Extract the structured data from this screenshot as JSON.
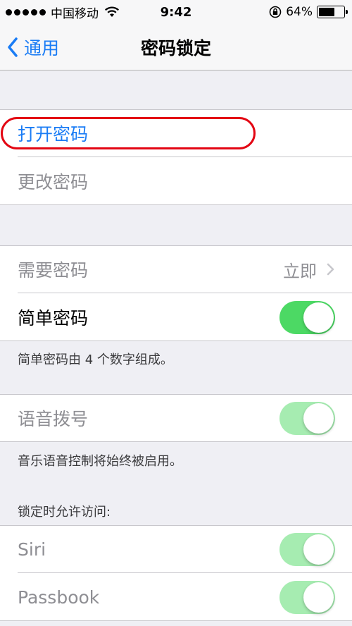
{
  "status_bar": {
    "carrier": "中国移动",
    "time": "9:42",
    "battery_percent": "64%",
    "battery_level": 0.64
  },
  "nav": {
    "back_label": "通用",
    "title": "密码锁定"
  },
  "section1": {
    "turn_on_passcode": "打开密码",
    "change_passcode": "更改密码"
  },
  "section2": {
    "require_passcode": "需要密码",
    "require_passcode_value": "立即",
    "simple_passcode": "简单密码",
    "simple_passcode_on": true,
    "footnote": "简单密码由 4 个数字组成。"
  },
  "section3": {
    "voice_dial": "语音拨号",
    "voice_dial_on": true,
    "footnote": "音乐语音控制将始终被启用。"
  },
  "section4": {
    "header": "锁定时允许访问:",
    "siri": "Siri",
    "siri_on": true,
    "passbook": "Passbook",
    "passbook_on": true
  },
  "colors": {
    "accent": "#1a7cf5",
    "toggle_on": "#4cd964",
    "highlight": "#e30613"
  }
}
